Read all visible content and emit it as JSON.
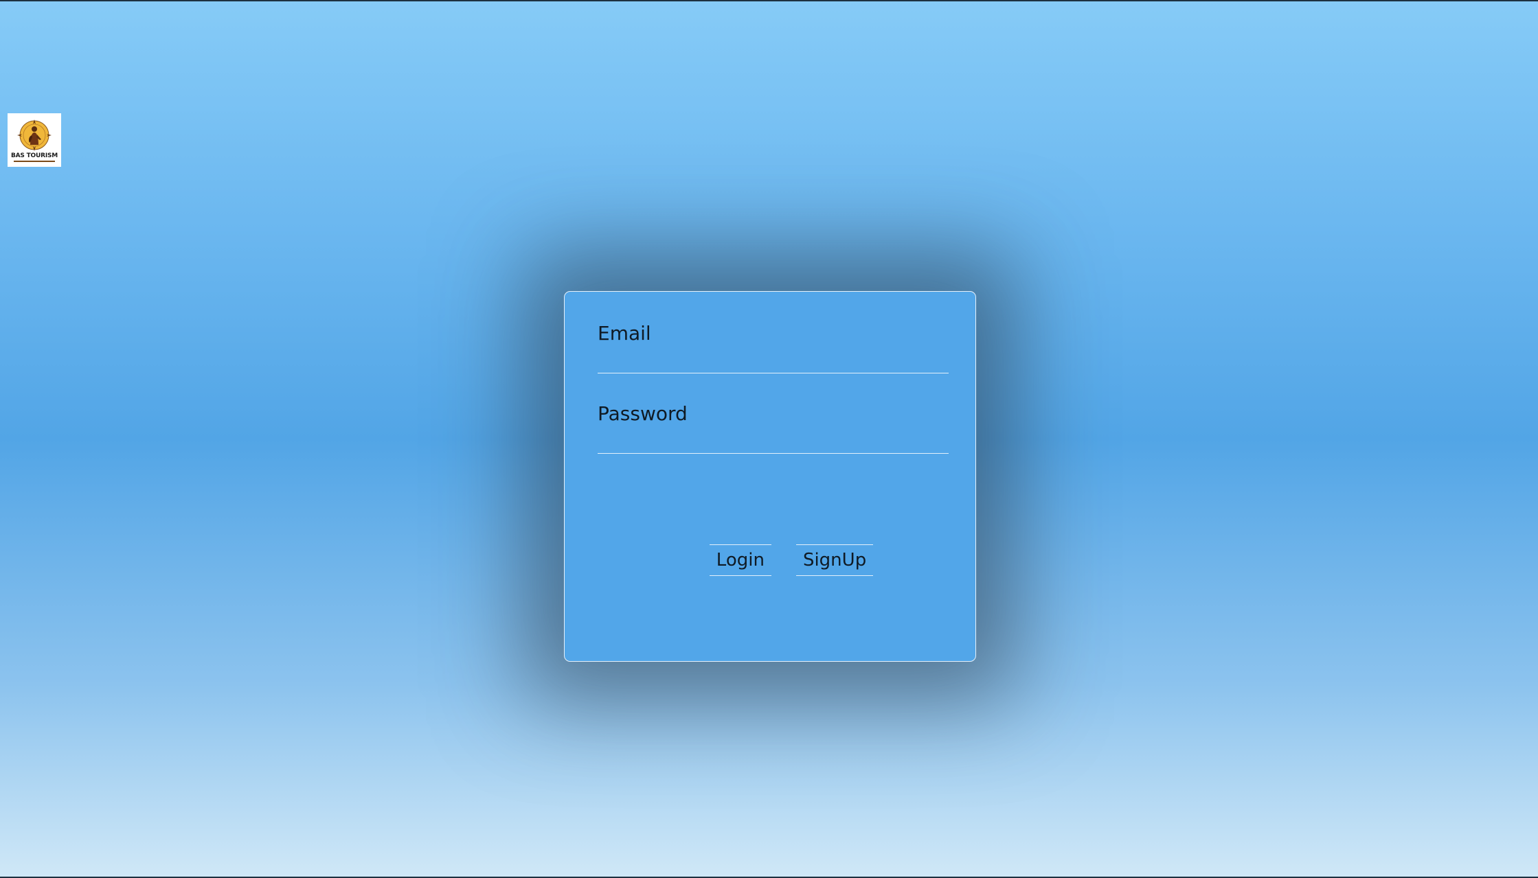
{
  "logo": {
    "text": "BAS TOURISM",
    "alt": "BAS TOURISM logo"
  },
  "form": {
    "email_label": "Email",
    "email_value": "",
    "password_label": "Password",
    "password_value": "",
    "login_label": "Login",
    "signup_label": "SignUp"
  },
  "colors": {
    "card_background": "#52a6e9",
    "page_top": "#86cbf7",
    "page_bottom": "#d0e8f7",
    "text": "#0f1a24"
  }
}
